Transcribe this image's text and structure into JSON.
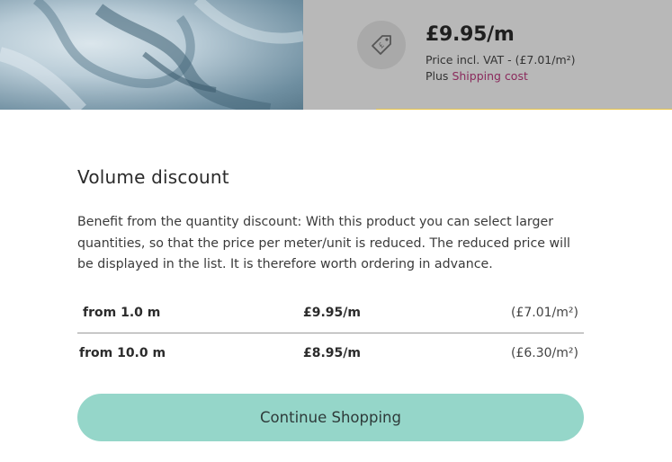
{
  "product": {
    "price": "£9.95/m",
    "price_vat": "Price incl. VAT - (£7.01/m²)",
    "shipping_prefix": "Plus",
    "shipping_link": "Shipping cost",
    "tag_icon": "price-tag-icon"
  },
  "modal": {
    "title": "Volume discount",
    "description": "Benefit from the quantity discount: With this product you can select larger quantities, so that the price per meter/unit is reduced. The reduced price will be displayed in the list. It is therefore worth ordering in advance.",
    "tiers": [
      {
        "quantity": "from 1.0 m",
        "price_per_meter": "£9.95/m",
        "price_per_sqm": "(£7.01/m²)"
      },
      {
        "quantity": "from 10.0 m",
        "price_per_meter": "£8.95/m",
        "price_per_sqm": "(£6.30/m²)"
      }
    ],
    "continue_label": "Continue Shopping"
  },
  "colors": {
    "button": "#95d6c9",
    "shipping_link": "#8a2a5c",
    "accent_line": "#e8c54a"
  }
}
